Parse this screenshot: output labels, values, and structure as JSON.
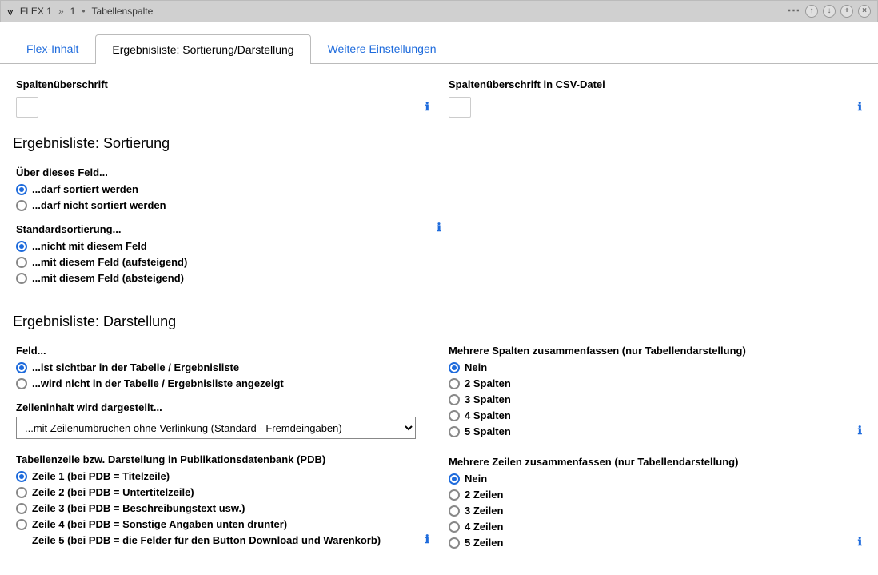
{
  "title": {
    "part1": "FLEX 1",
    "part2": "1",
    "part3": "Tabellenspalte"
  },
  "tabs": {
    "t0": "Flex-Inhalt",
    "t1": "Ergebnisliste: Sortierung/Darstellung",
    "t2": "Weitere Einstellungen"
  },
  "top": {
    "col_header": "Spaltenüberschrift",
    "col_header_csv": "Spaltenüberschrift in CSV-Datei"
  },
  "sec_sort": "Ergebnisliste: Sortierung",
  "sort_field": {
    "title": "Über dieses Feld...",
    "o0": "...darf sortiert werden",
    "o1": "...darf nicht sortiert werden"
  },
  "default_sort": {
    "title": "Standardsortierung...",
    "o0": "...nicht mit diesem Feld",
    "o1": "...mit diesem Feld (aufsteigend)",
    "o2": "...mit diesem Feld (absteigend)"
  },
  "sec_display": "Ergebnisliste: Darstellung",
  "field_vis": {
    "title": "Feld...",
    "o0": "...ist sichtbar in der Tabelle / Ergebnisliste",
    "o1": "...wird nicht in der Tabelle / Ergebnisliste angezeigt"
  },
  "cell": {
    "title": "Zelleninhalt wird dargestellt...",
    "selected": "...mit Zeilenumbrüchen ohne Verlinkung (Standard - Fremdeingaben)"
  },
  "pdb": {
    "title": "Tabellenzeile bzw. Darstellung in Publikationsdatenbank (PDB)",
    "o0": "Zeile 1 (bei PDB = Titelzeile)",
    "o1": "Zeile 2 (bei PDB = Untertitelzeile)",
    "o2": "Zeile 3 (bei PDB = Beschreibungstext usw.)",
    "o3": "Zeile 4 (bei PDB = Sonstige Angaben unten drunter)",
    "o4": "Zeile 5 (bei PDB = die Felder für den Button Download und Warenkorb)"
  },
  "cols": {
    "title": "Mehrere Spalten zusammenfassen (nur Tabellendarstellung)",
    "o0": "Nein",
    "o1": "2 Spalten",
    "o2": "3 Spalten",
    "o3": "4 Spalten",
    "o4": "5 Spalten"
  },
  "rows": {
    "title": "Mehrere Zeilen zusammenfassen (nur Tabellendarstellung)",
    "o0": "Nein",
    "o1": "2 Zeilen",
    "o2": "3 Zeilen",
    "o3": "4 Zeilen",
    "o4": "5 Zeilen"
  }
}
